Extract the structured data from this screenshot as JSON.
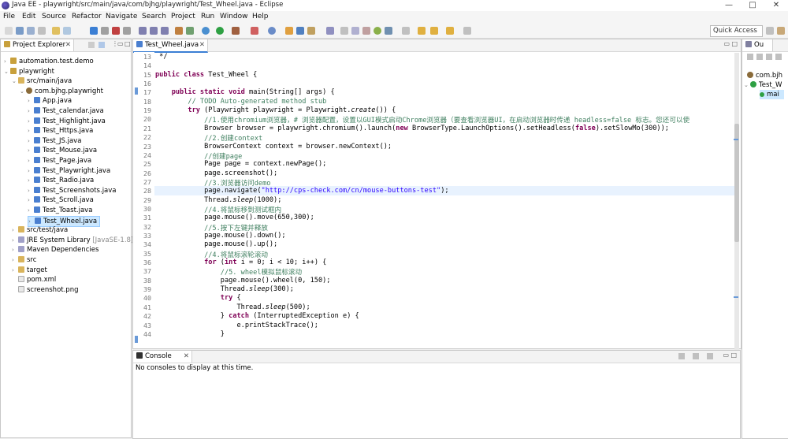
{
  "window": {
    "title": "Java EE - playwright/src/main/java/com/bjhg/playwright/Test_Wheel.java - Eclipse",
    "minimize": "—",
    "maximize": "□",
    "close": "✕"
  },
  "menu": [
    "File",
    "Edit",
    "Source",
    "Refactor",
    "Navigate",
    "Search",
    "Project",
    "Run",
    "Window",
    "Help"
  ],
  "toolbar": {
    "quick_access": "Quick Access"
  },
  "project_explorer": {
    "title": "Project Explorer",
    "items": [
      {
        "label": "automation.test.demo",
        "level": 0,
        "icon": "project",
        "twist": "›"
      },
      {
        "label": "playwright",
        "level": 0,
        "icon": "project",
        "twist": "⌄"
      },
      {
        "label": "src/main/java",
        "level": 1,
        "icon": "folder",
        "twist": "⌄"
      },
      {
        "label": "com.bjhg.playwright",
        "level": 2,
        "icon": "package",
        "twist": "⌄"
      },
      {
        "label": "App.java",
        "level": 3,
        "icon": "java",
        "twist": "›"
      },
      {
        "label": "Test_calendar.java",
        "level": 3,
        "icon": "java",
        "twist": "›"
      },
      {
        "label": "Test_Highlight.java",
        "level": 3,
        "icon": "java",
        "twist": "›"
      },
      {
        "label": "Test_Https.java",
        "level": 3,
        "icon": "java",
        "twist": "›"
      },
      {
        "label": "Test_JS.java",
        "level": 3,
        "icon": "java",
        "twist": "›"
      },
      {
        "label": "Test_Mouse.java",
        "level": 3,
        "icon": "java",
        "twist": "›"
      },
      {
        "label": "Test_Page.java",
        "level": 3,
        "icon": "java",
        "twist": "›"
      },
      {
        "label": "Test_Playwright.java",
        "level": 3,
        "icon": "java",
        "twist": "›"
      },
      {
        "label": "Test_Radio.java",
        "level": 3,
        "icon": "java",
        "twist": "›"
      },
      {
        "label": "Test_Screenshots.java",
        "level": 3,
        "icon": "java",
        "twist": "›"
      },
      {
        "label": "Test_Scroll.java",
        "level": 3,
        "icon": "java",
        "twist": "›"
      },
      {
        "label": "Test_Toast.java",
        "level": 3,
        "icon": "java",
        "twist": "›"
      },
      {
        "label": "Test_Wheel.java",
        "level": 3,
        "icon": "java",
        "twist": "›",
        "selected": true
      },
      {
        "label": "src/test/java",
        "level": 1,
        "icon": "folder",
        "twist": "›"
      },
      {
        "label": "JRE System Library",
        "suffix": " [JavaSE-1.8]",
        "level": 1,
        "icon": "library",
        "twist": "›"
      },
      {
        "label": "Maven Dependencies",
        "level": 1,
        "icon": "library",
        "twist": "›"
      },
      {
        "label": "src",
        "level": 1,
        "icon": "folder",
        "twist": "›"
      },
      {
        "label": "target",
        "level": 1,
        "icon": "folder",
        "twist": "›"
      },
      {
        "label": "pom.xml",
        "level": 1,
        "icon": "file",
        "twist": ""
      },
      {
        "label": "screenshot.png",
        "level": 1,
        "icon": "file",
        "twist": ""
      }
    ]
  },
  "editor": {
    "tab": "Test_Wheel.java",
    "highlight_line": 28,
    "lines": [
      {
        "n": 13,
        "t": [
          [
            "",
            " */"
          ]
        ]
      },
      {
        "n": 14,
        "t": [
          [
            "",
            ""
          ]
        ]
      },
      {
        "n": 15,
        "t": [
          [
            "kw",
            "public class"
          ],
          [
            "",
            " Test_Wheel {"
          ]
        ]
      },
      {
        "n": 16,
        "t": [
          [
            "",
            ""
          ]
        ]
      },
      {
        "n": 17,
        "t": [
          [
            "",
            "    "
          ],
          [
            "kw",
            "public static void"
          ],
          [
            "",
            " main(String[] args) {"
          ]
        ]
      },
      {
        "n": 18,
        "t": [
          [
            "cm",
            "        // TODO Auto-generated method stub"
          ]
        ]
      },
      {
        "n": 19,
        "t": [
          [
            "",
            "        "
          ],
          [
            "kw",
            "try"
          ],
          [
            "",
            " (Playwright playwright = Playwright."
          ],
          [
            "it",
            "create"
          ],
          [
            "",
            "()) {"
          ]
        ]
      },
      {
        "n": 20,
        "t": [
          [
            "cm",
            "            //1.使用chromium浏览器，# 浏览器配置，设置以GUI模式启动Chrome浏览器（要查看浏览器UI，在启动浏览器时传递 headless=false 标志。您还可以使"
          ]
        ]
      },
      {
        "n": 21,
        "t": [
          [
            "",
            "            Browser browser = playwright.chromium().launch("
          ],
          [
            "kw",
            "new"
          ],
          [
            "",
            " BrowserType.LaunchOptions().setHeadless("
          ],
          [
            "kw",
            "false"
          ],
          [
            "",
            ").setSlowMo(300));"
          ]
        ]
      },
      {
        "n": 22,
        "t": [
          [
            "cm",
            "            //2.创建context"
          ]
        ]
      },
      {
        "n": 23,
        "t": [
          [
            "",
            "            BrowserContext context = browser.newContext();"
          ]
        ]
      },
      {
        "n": 24,
        "t": [
          [
            "cm",
            "            //创建page"
          ]
        ]
      },
      {
        "n": 25,
        "t": [
          [
            "",
            "            Page page = context.newPage();"
          ]
        ]
      },
      {
        "n": 26,
        "t": [
          [
            "",
            "            page.screenshot();"
          ]
        ]
      },
      {
        "n": 27,
        "t": [
          [
            "cm",
            "            //3.浏览器访问demo"
          ]
        ]
      },
      {
        "n": 28,
        "t": [
          [
            "",
            "            page.navigate("
          ],
          [
            "str",
            "\"http://cps-check.com/cn/mouse-buttons-test\""
          ],
          [
            "",
            ");"
          ]
        ]
      },
      {
        "n": 29,
        "t": [
          [
            "",
            "            Thread."
          ],
          [
            "it",
            "sleep"
          ],
          [
            "",
            "(1000);"
          ]
        ]
      },
      {
        "n": 30,
        "t": [
          [
            "cm",
            "            //4.将鼠标移到测试框内"
          ]
        ]
      },
      {
        "n": 31,
        "t": [
          [
            "",
            "            page.mouse().move(650,300);"
          ]
        ]
      },
      {
        "n": 32,
        "t": [
          [
            "cm",
            "            //5.按下左键并释放"
          ]
        ]
      },
      {
        "n": 33,
        "t": [
          [
            "",
            "            page.mouse().down();"
          ]
        ]
      },
      {
        "n": 34,
        "t": [
          [
            "",
            "            page.mouse().up();"
          ]
        ]
      },
      {
        "n": 35,
        "t": [
          [
            "cm",
            "            //4.将鼠标滚轮滚动"
          ]
        ]
      },
      {
        "n": 36,
        "t": [
          [
            "",
            "            "
          ],
          [
            "kw",
            "for"
          ],
          [
            "",
            " ("
          ],
          [
            "kw",
            "int"
          ],
          [
            "",
            " i = 0; i < 10; i++) {"
          ]
        ]
      },
      {
        "n": 37,
        "t": [
          [
            "cm",
            "                //5. wheel模拟鼠标滚动"
          ]
        ]
      },
      {
        "n": 38,
        "t": [
          [
            "",
            "                page.mouse().wheel(0, 150);"
          ]
        ]
      },
      {
        "n": 39,
        "t": [
          [
            "",
            "                Thread."
          ],
          [
            "it",
            "sleep"
          ],
          [
            "",
            "(300);"
          ]
        ]
      },
      {
        "n": 40,
        "t": [
          [
            "",
            "                "
          ],
          [
            "kw",
            "try"
          ],
          [
            "",
            " {"
          ]
        ]
      },
      {
        "n": 41,
        "t": [
          [
            "",
            "                    Thread."
          ],
          [
            "it",
            "sleep"
          ],
          [
            "",
            "(500);"
          ]
        ]
      },
      {
        "n": 42,
        "t": [
          [
            "",
            "                } "
          ],
          [
            "kw",
            "catch"
          ],
          [
            "",
            " (InterruptedException e) {"
          ]
        ]
      },
      {
        "n": 43,
        "t": [
          [
            "",
            "                    e.printStackTrace();"
          ]
        ]
      },
      {
        "n": 44,
        "t": [
          [
            "",
            "                }"
          ]
        ]
      }
    ]
  },
  "console": {
    "title": "Console",
    "message": "No consoles to display at this time."
  },
  "outline": {
    "title": "Ou",
    "items": [
      {
        "label": "com.bjh"
      },
      {
        "label": "Test_W"
      },
      {
        "label": "mai"
      }
    ]
  },
  "colors": {
    "keyword": "#7f0055",
    "comment": "#3f7f5f",
    "string": "#2a00ff",
    "highlight": "#e8f2fe",
    "selection": "#cce8ff"
  }
}
